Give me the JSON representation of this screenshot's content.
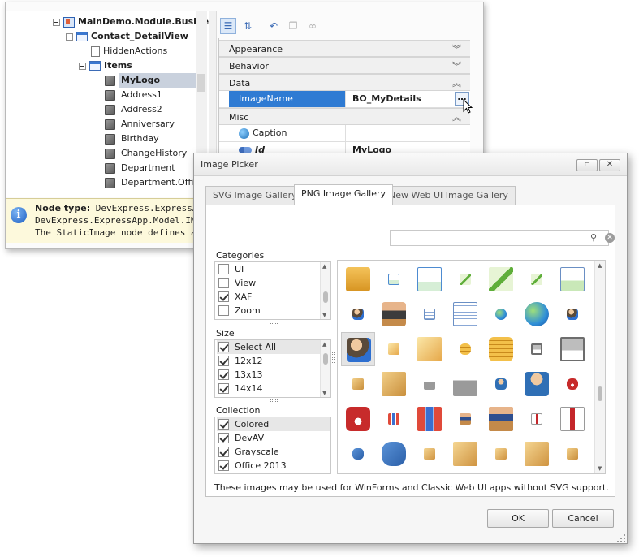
{
  "model_tree": {
    "nodes": [
      {
        "label": "MainDemo.Module.Business",
        "icon": "module-icon"
      },
      {
        "label": "Contact_DetailView",
        "icon": "detail-view-icon"
      },
      {
        "label": "HiddenActions",
        "icon": "file-icon"
      },
      {
        "label": "Items",
        "icon": "items-icon"
      },
      {
        "label": "MyLogo",
        "icon": "cube-icon"
      },
      {
        "label": "Address1",
        "icon": "cube-icon"
      },
      {
        "label": "Address2",
        "icon": "cube-icon"
      },
      {
        "label": "Anniversary",
        "icon": "cube-icon"
      },
      {
        "label": "Birthday",
        "icon": "cube-icon"
      },
      {
        "label": "ChangeHistory",
        "icon": "cube-icon"
      },
      {
        "label": "Department",
        "icon": "cube-icon"
      },
      {
        "label": "Department.Office",
        "icon": "cube-icon"
      }
    ]
  },
  "info_panel": {
    "node_type_label": "Node type:",
    "node_type_value": "DevExpress.ExpressApp.Model.IModelStaticImage",
    "line2": "DevExpress.ExpressApp.Model.IModelStaticImage",
    "line3": "The StaticImage node defines a ViewItem that displays a static image."
  },
  "toolbar": {
    "categorized": "categorized-icon",
    "alphabetical": "alphabetical-icon",
    "undo": "undo-icon",
    "copy": "copy-icon",
    "link": "link-icon"
  },
  "property_grid": {
    "categories": [
      {
        "label": "Appearance",
        "state": "collapsed"
      },
      {
        "label": "Behavior",
        "state": "collapsed"
      },
      {
        "label": "Data",
        "state": "expanded"
      },
      {
        "label": "Misc",
        "state": "expanded"
      }
    ],
    "rows": {
      "image_name": {
        "name": "ImageName",
        "value": "BO_MyDetails",
        "ellipsis": "…"
      },
      "caption": {
        "name": "Caption",
        "value": ""
      },
      "id": {
        "name": "Id",
        "value": "MyLogo"
      }
    }
  },
  "dialog": {
    "title": "Image Picker",
    "tabs": [
      "SVG Image Gallery",
      "PNG Image Gallery",
      "New Web UI Image Gallery"
    ],
    "active_tab": "PNG Image Gallery",
    "search": {
      "value": "",
      "placeholder": ""
    },
    "categories_label": "Categories",
    "categories": [
      {
        "label": "UI",
        "checked": false
      },
      {
        "label": "View",
        "checked": false
      },
      {
        "label": "XAF",
        "checked": true
      },
      {
        "label": "Zoom",
        "checked": false
      }
    ],
    "size_label": "Size",
    "sizes": [
      {
        "label": "Select All",
        "checked": true
      },
      {
        "label": "12x12",
        "checked": true
      },
      {
        "label": "13x13",
        "checked": true
      },
      {
        "label": "14x14",
        "checked": true
      }
    ],
    "collection_label": "Collection",
    "collections": [
      {
        "label": "Colored",
        "checked": true
      },
      {
        "label": "DevAV",
        "checked": true
      },
      {
        "label": "Grayscale",
        "checked": true
      },
      {
        "label": "Office 2013",
        "checked": true
      }
    ],
    "note": "These images may be used for WinForms and Classic Web UI apps without SVG support.",
    "ok_label": "OK",
    "cancel_label": "Cancel",
    "gallery_icons": [
      [
        "folder-icon",
        "dollar-doc-sm-icon",
        "dollar-doc-icon",
        "chart-sm-icon",
        "chart-icon",
        "chart-sm2-icon",
        "chart-doc-icon"
      ],
      [
        "person-info-sm-icon",
        "person-desk-icon",
        "doc-sm-icon",
        "doc-icon",
        "globe-sm-icon",
        "globe-icon",
        "person-info-sm2-icon"
      ],
      [
        "person-info-icon",
        "note-sm-icon",
        "notes-icon",
        "coins-sm-icon",
        "coins-icon",
        "cart-sm-icon",
        "cart-icon"
      ],
      [
        "box-cart-sm-icon",
        "box-cart-icon",
        "factory-sm-icon",
        "factory-icon",
        "person-sm-icon",
        "person-icon",
        "phone-sm-icon"
      ],
      [
        "phone-icon",
        "bar-chart-sm-icon",
        "bar-chart-icon",
        "desk-sm-icon",
        "desk-icon",
        "shirt-sm-icon",
        "shirt-icon"
      ],
      [
        "tag-sm-icon",
        "tag-icon",
        "box-sm-icon",
        "box-icon",
        "box-sm2-icon",
        "box2-icon",
        "boxes-sm-icon"
      ]
    ]
  }
}
